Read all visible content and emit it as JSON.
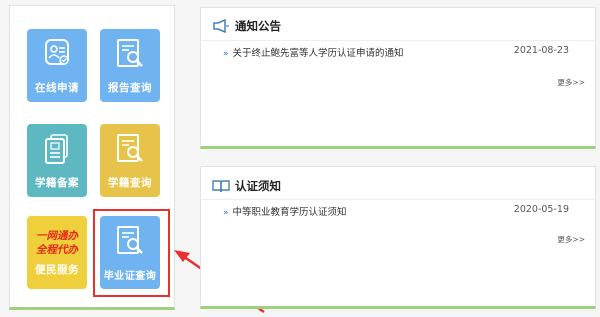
{
  "tiles": {
    "online_apply": "在线申请",
    "report_query": "报告查询",
    "status_record": "学籍备案",
    "status_query": "学籍查询",
    "slogan_line1": "一网通办",
    "slogan_line2": "全程代办",
    "citizen_service": "便民服务",
    "cert_query": "毕业证查询"
  },
  "notice": {
    "title": "通知公告",
    "items": [
      {
        "text": "关于终止鲍先富等人学历认证申请的通知",
        "date": "2021-08-23"
      }
    ],
    "more": "更多>>"
  },
  "guide": {
    "title": "认证须知",
    "items": [
      {
        "text": "中等职业教育学历认证须知",
        "date": "2020-05-19"
      }
    ],
    "more": "更多>>"
  },
  "colors": {
    "tile_blue": "#6fb3f0",
    "tile_teal": "#5eb8c2",
    "tile_yellow": "#e7c449",
    "highlight": "#e8302f",
    "accent_green": "#9fd07c"
  }
}
